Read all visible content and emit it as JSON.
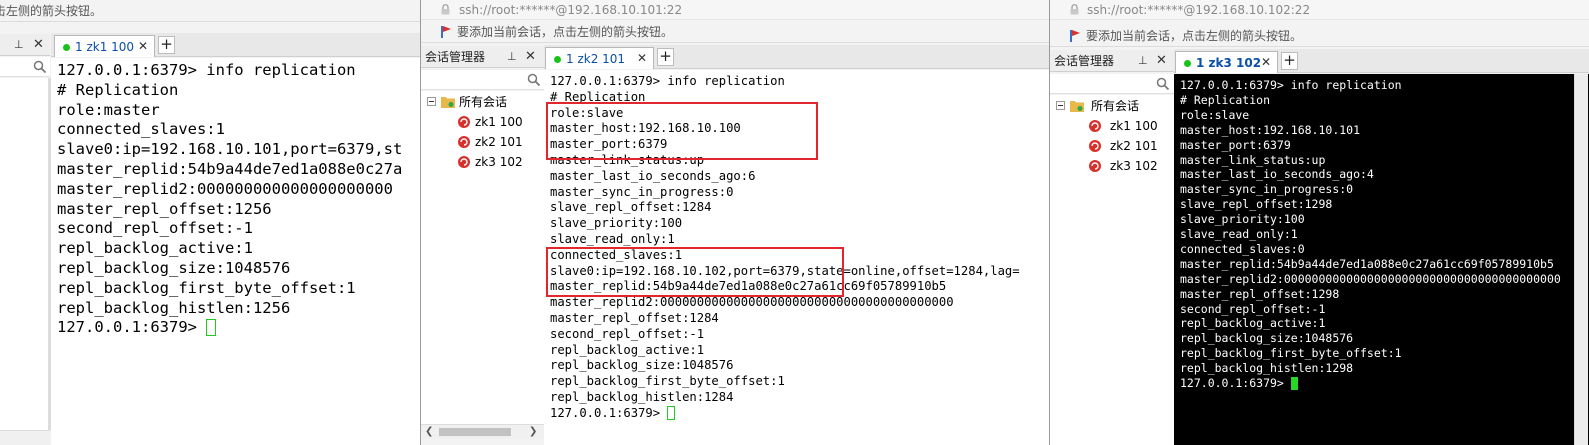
{
  "windows": [
    {
      "hint_text": "击左侧的箭头按钮。",
      "tab_label": "1 zk1 100",
      "terminal_lines": [
        "127.0.0.1:6379> info replication",
        "# Replication",
        "role:master",
        "connected_slaves:1",
        "slave0:ip=192.168.10.101,port=6379,st",
        "master_replid:54b9a44de7ed1a088e0c27a",
        "master_replid2:000000000000000000000",
        "master_repl_offset:1256",
        "second_repl_offset:-1",
        "repl_backlog_active:1",
        "repl_backlog_size:1048576",
        "repl_backlog_first_byte_offset:1",
        "repl_backlog_histlen:1256",
        "127.0.0.1:6379> "
      ]
    },
    {
      "address": "ssh://root:******@192.168.10.101:22",
      "hint_text": "要添加当前会话，点击左侧的箭头按钮。",
      "session_manager_title": "会话管理器",
      "tree_root": "所有会话",
      "sessions": [
        "zk1 100",
        "zk2 101",
        "zk3 102"
      ],
      "tab_label": "1 zk2 101",
      "terminal_lines": [
        "127.0.0.1:6379> info replication",
        "# Replication",
        "role:slave",
        "master_host:192.168.10.100",
        "master_port:6379",
        "master_link_status:up",
        "master_last_io_seconds_ago:6",
        "master_sync_in_progress:0",
        "slave_repl_offset:1284",
        "slave_priority:100",
        "slave_read_only:1",
        "connected_slaves:1",
        "slave0:ip=192.168.10.102,port=6379,state=online,offset=1284,lag=",
        "master_replid:54b9a44de7ed1a088e0c27a61cc69f05789910b5",
        "master_replid2:0000000000000000000000000000000000000000",
        "master_repl_offset:1284",
        "second_repl_offset:-1",
        "repl_backlog_active:1",
        "repl_backlog_size:1048576",
        "repl_backlog_first_byte_offset:1",
        "repl_backlog_histlen:1284",
        "127.0.0.1:6379> "
      ]
    },
    {
      "address": "ssh://root:******@192.168.10.102:22",
      "hint_text": "要添加当前会话，点击左侧的箭头按钮。",
      "session_manager_title": "会话管理器",
      "tree_root": "所有会话",
      "sessions": [
        "zk1 100",
        "zk2 101",
        "zk3 102"
      ],
      "tab_label": "1 zk3 102",
      "terminal_lines": [
        "127.0.0.1:6379> info replication",
        "# Replication",
        "role:slave",
        "master_host:192.168.10.101",
        "master_port:6379",
        "master_link_status:up",
        "master_last_io_seconds_ago:4",
        "master_sync_in_progress:0",
        "slave_repl_offset:1298",
        "slave_priority:100",
        "slave_read_only:1",
        "connected_slaves:0",
        "master_replid:54b9a44de7ed1a088e0c27a61cc69f05789910b5",
        "master_replid2:0000000000000000000000000000000000000000",
        "master_repl_offset:1298",
        "second_repl_offset:-1",
        "repl_backlog_active:1",
        "repl_backlog_size:1048576",
        "repl_backlog_first_byte_offset:1",
        "repl_backlog_histlen:1298",
        "127.0.0.1:6379> "
      ]
    }
  ],
  "colors": {
    "highlight_box": "#e3262d",
    "tab_active_dot": "#19c219",
    "cursor": "#22c922",
    "terminal_dark_bg": "#000000",
    "session_icon": "#d9302c",
    "folder": "#e8b84a"
  }
}
